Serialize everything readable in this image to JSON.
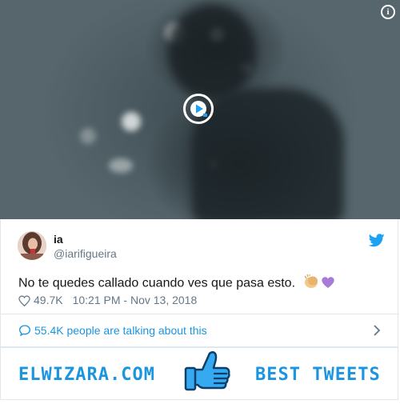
{
  "media": {
    "info_icon_glyph": "i",
    "play_icon": "play-icon"
  },
  "tweet": {
    "display_name": "ia",
    "handle": "@iarifigueira",
    "text": "No te quedes callado cuando ves que pasa esto.",
    "emojis": [
      "clapping-hands",
      "purple-heart"
    ],
    "likes": "49.7K",
    "timestamp": "10:21 PM - Nov 13, 2018"
  },
  "conversation": {
    "label": "55.4K people are talking about this"
  },
  "banner": {
    "left_text": "ELWIZARA.COM",
    "right_text": "BEST TWEETS"
  },
  "colors": {
    "twitter_blue": "#1da1f2",
    "link_blue": "#1b95e0",
    "muted_gray": "#657786",
    "border": "#e1e8ed"
  }
}
